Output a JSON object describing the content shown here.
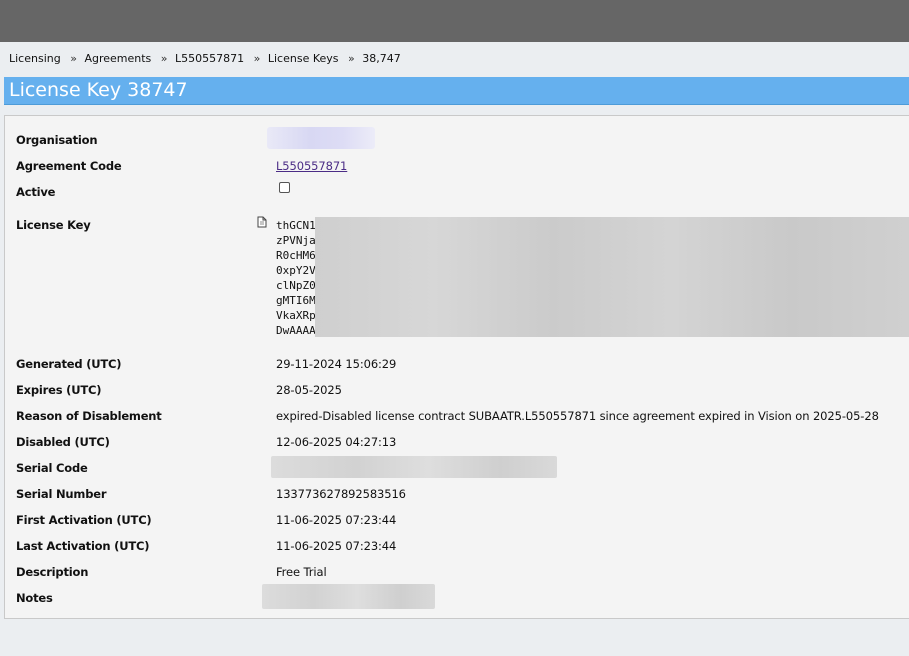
{
  "breadcrumb": {
    "items": [
      "Licensing",
      "Agreements",
      "L550557871",
      "License Keys",
      "38,747"
    ],
    "separator": "»"
  },
  "page_title": "License Key 38747",
  "fields": {
    "organisation": {
      "label": "Organisation"
    },
    "agreement_code": {
      "label": "Agreement Code",
      "value": "L550557871"
    },
    "active": {
      "label": "Active",
      "checked": false
    },
    "license_key": {
      "label": "License Key",
      "visible_lines": [
        "thGCN1",
        "zPVNja",
        "R0cHM6",
        "0xpY2V",
        "clNpZ0",
        "gMTI6M",
        "VkaXRp",
        "DwAAAA"
      ]
    },
    "generated": {
      "label": "Generated (UTC)",
      "value": "29-11-2024 15:06:29"
    },
    "expires": {
      "label": "Expires (UTC)",
      "value": "28-05-2025"
    },
    "reason_disablement": {
      "label": "Reason of Disablement",
      "value": "expired-Disabled license contract SUBAATR.L550557871 since agreement expired in Vision on 2025-05-28"
    },
    "disabled": {
      "label": "Disabled (UTC)",
      "value": "12-06-2025 04:27:13"
    },
    "serial_code": {
      "label": "Serial Code"
    },
    "serial_number": {
      "label": "Serial Number",
      "value": "133773627892583516"
    },
    "first_activation": {
      "label": "First Activation (UTC)",
      "value": "11-06-2025 07:23:44"
    },
    "last_activation": {
      "label": "Last Activation (UTC)",
      "value": "11-06-2025 07:23:44"
    },
    "description": {
      "label": "Description",
      "value": "Free Trial"
    },
    "notes": {
      "label": "Notes"
    }
  },
  "icons": {
    "copy": "copy-icon"
  },
  "colors": {
    "topbar": "#666666",
    "title_bar": "#65b0ee",
    "link": "#4b2c86",
    "panel": "#f4f4f4",
    "page_bg": "#ebeef1"
  }
}
